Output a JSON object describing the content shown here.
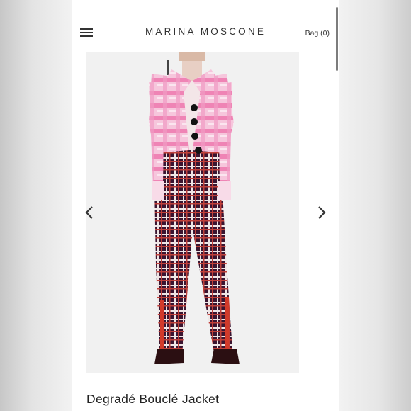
{
  "header": {
    "brand": "MARINA MOSCONE",
    "bag_label": "Bag (0)"
  },
  "product": {
    "title": "Degradé Bouclé Jacket"
  },
  "icons": {
    "menu": "hamburger-menu-icon",
    "prev": "chevron-left-icon",
    "next": "chevron-right-icon"
  },
  "colors": {
    "jacket_pink": "#f080b4",
    "trouser_plaid_base": "#3b1a35",
    "trouser_stripe": "#c23a2c"
  }
}
